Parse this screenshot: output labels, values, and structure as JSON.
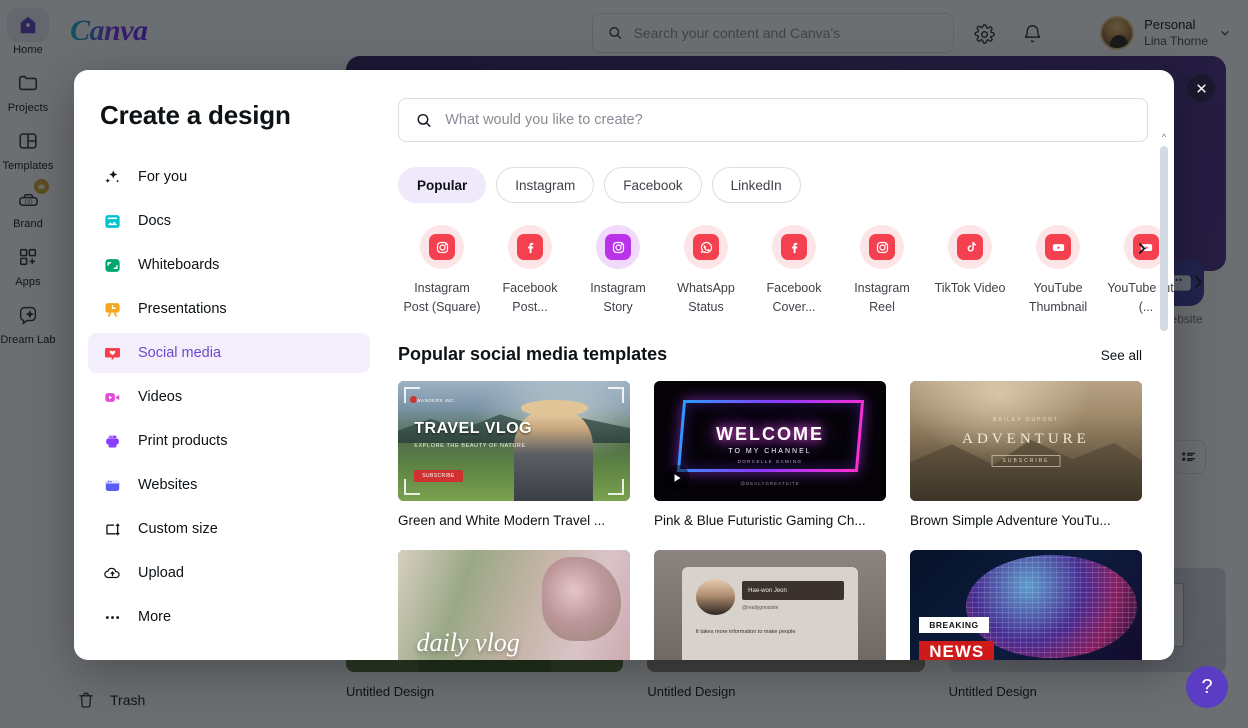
{
  "app": {
    "logo_text": "Canva",
    "rail": [
      {
        "label": "Home",
        "icon": "home-icon",
        "active": true,
        "pro": false
      },
      {
        "label": "Projects",
        "icon": "folder-icon",
        "active": false,
        "pro": false
      },
      {
        "label": "Templates",
        "icon": "templates-icon",
        "active": false,
        "pro": false
      },
      {
        "label": "Brand",
        "icon": "brand-icon",
        "active": false,
        "pro": true
      },
      {
        "label": "Apps",
        "icon": "apps-icon",
        "active": false,
        "pro": false
      },
      {
        "label": "Dream Lab",
        "icon": "dream-lab-icon",
        "active": false,
        "pro": false
      }
    ],
    "trash_label": "Trash",
    "topbar": {
      "search_placeholder": "Search your content and Canva's",
      "search_value": "",
      "settings_icon": "gear-icon",
      "notifications_icon": "bell-icon",
      "account_type": "Personal",
      "account_name": "Lina Thorne",
      "chevron_icon": "chevron-down-icon"
    },
    "background": {
      "website_chip_label": "Website",
      "list_view_icon": "list-view-icon",
      "next_icon": "chevron-right-icon",
      "cards": [
        {
          "label": "Untitled Design"
        },
        {
          "label": "Untitled Design"
        },
        {
          "label": "Untitled Design"
        }
      ]
    },
    "help_button": "?"
  },
  "modal": {
    "title": "Create a design",
    "close_icon": "close-icon",
    "search": {
      "icon": "search-icon",
      "placeholder": "What would you like to create?",
      "value": ""
    },
    "nav": [
      {
        "label": "For you",
        "icon": "sparkles-icon",
        "active": false
      },
      {
        "label": "Docs",
        "icon": "docs-icon",
        "active": false
      },
      {
        "label": "Whiteboards",
        "icon": "whiteboard-icon",
        "active": false
      },
      {
        "label": "Presentations",
        "icon": "presentation-icon",
        "active": false
      },
      {
        "label": "Social media",
        "icon": "heart-icon",
        "active": true
      },
      {
        "label": "Videos",
        "icon": "video-icon",
        "active": false
      },
      {
        "label": "Print products",
        "icon": "printer-icon",
        "active": false
      },
      {
        "label": "Websites",
        "icon": "website-icon",
        "active": false
      },
      {
        "label": "Custom size",
        "icon": "custom-size-icon",
        "active": false
      },
      {
        "label": "Upload",
        "icon": "upload-icon",
        "active": false
      },
      {
        "label": "More",
        "icon": "more-dots-icon",
        "active": false
      }
    ],
    "chips": [
      {
        "label": "Popular",
        "active": true
      },
      {
        "label": "Instagram",
        "active": false
      },
      {
        "label": "Facebook",
        "active": false
      },
      {
        "label": "LinkedIn",
        "active": false
      }
    ],
    "design_types": [
      {
        "label": "Instagram Post (Square)",
        "icon": "instagram-icon",
        "bg": "#fde4e6",
        "tile": "#f5414f"
      },
      {
        "label": "Facebook Post...",
        "icon": "facebook-icon",
        "bg": "#fde4e6",
        "tile": "#f5414f"
      },
      {
        "label": "Instagram Story",
        "icon": "instagram-icon",
        "bg": "#f1d9fb",
        "tile": "#bb33e8"
      },
      {
        "label": "WhatsApp Status",
        "icon": "whatsapp-icon",
        "bg": "#fde4e6",
        "tile": "#f5414f"
      },
      {
        "label": "Facebook Cover...",
        "icon": "facebook-icon",
        "bg": "#fde4e6",
        "tile": "#f5414f"
      },
      {
        "label": "Instagram Reel",
        "icon": "instagram-icon",
        "bg": "#fde4e6",
        "tile": "#f5414f"
      },
      {
        "label": "TikTok Video",
        "icon": "tiktok-icon",
        "bg": "#fde4e6",
        "tile": "#f5414f"
      },
      {
        "label": "YouTube Thumbnail",
        "icon": "youtube-icon",
        "bg": "#fde4e6",
        "tile": "#f5414f"
      },
      {
        "label": "YouTube Intro (...",
        "icon": "youtube-icon",
        "bg": "#fde4e6",
        "tile": "#f5414f"
      }
    ],
    "types_next_icon": "chevron-right-icon",
    "section": {
      "title": "Popular social media templates",
      "see_all": "See all"
    },
    "templates": [
      {
        "label": "Green and White Modern Travel ...",
        "art": "travel"
      },
      {
        "label": "Pink & Blue Futuristic Gaming Ch...",
        "art": "gaming",
        "play": true
      },
      {
        "label": "Brown Simple Adventure YouTu...",
        "art": "adventure"
      },
      {
        "label": "",
        "art": "daily"
      },
      {
        "label": "",
        "art": "social"
      },
      {
        "label": "",
        "art": "news"
      }
    ],
    "template_art": {
      "travel": {
        "brand": "WANDERS INC.",
        "title": "TRAVEL VLOG",
        "subtitle": "EXPLORE THE BEAUTY OF NATURE",
        "button": "SUBSCRIBE"
      },
      "gaming": {
        "welcome": "WELCOME",
        "channel": "TO MY CHANNEL",
        "sub": "DORCELLE GAMING",
        "handle": "@DEALYGREATSITE"
      },
      "adventure": {
        "brand": "BAILEY DUPONT",
        "title": "ADVENTURE",
        "button": "SUBSCRIBE"
      },
      "daily": {
        "title": "daily vlog"
      },
      "social": {
        "name": "Hae-won Jeon",
        "handle": "@reallygreatsite",
        "body": "It takes more information to make people"
      },
      "news": {
        "breaking": "BREAKING",
        "news": "NEWS"
      }
    },
    "scrollbar": {
      "up_icon": "chevron-up-icon",
      "down_icon": "chevron-down-icon"
    }
  },
  "colors": {
    "accent_purple": "#6e49cb",
    "active_nav_bg": "#f4eefd",
    "chip_active_bg": "#f0e9fb",
    "brand_crown": "#d4a72c",
    "help_bg": "#5b3cc4"
  }
}
